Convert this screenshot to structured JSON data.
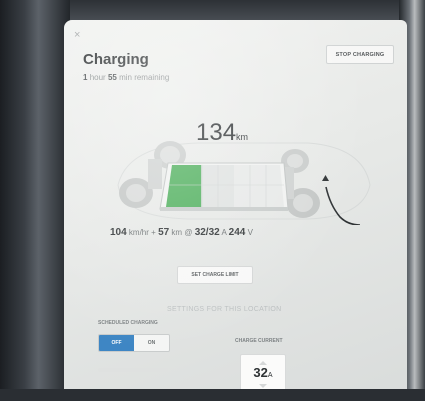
{
  "header": {
    "title": "Charging",
    "remaining": {
      "hours": "1",
      "hour_label": "hour",
      "minutes": "55",
      "minute_label": "min remaining"
    },
    "close_symbol": "×",
    "stop_button": "STOP CHARGING"
  },
  "range": {
    "value": "134",
    "unit": "km"
  },
  "battery": {
    "charge_fraction": 0.27
  },
  "stats": {
    "rate": "104",
    "rate_unit": "km/hr",
    "added_prefix": "+",
    "added": "57",
    "added_unit": "km",
    "current_prefix": "@",
    "current": "32/32",
    "current_unit": "A",
    "voltage": "244",
    "voltage_unit": "V"
  },
  "set_limit_button": "SET CHARGE LIMIT",
  "location_section": "SETTINGS FOR THIS LOCATION",
  "scheduled": {
    "label": "SCHEDULED CHARGING",
    "off": "OFF",
    "on": "ON",
    "selected": "OFF"
  },
  "charge_current": {
    "label": "CHARGE CURRENT",
    "value": "32",
    "unit": "A"
  },
  "colors": {
    "accent": "#3e86c4",
    "charge": "#4cae5a",
    "background": "#eceeed"
  },
  "icons": [
    "close-icon",
    "charge-cable-icon",
    "chevron-up-icon",
    "chevron-down-icon"
  ]
}
